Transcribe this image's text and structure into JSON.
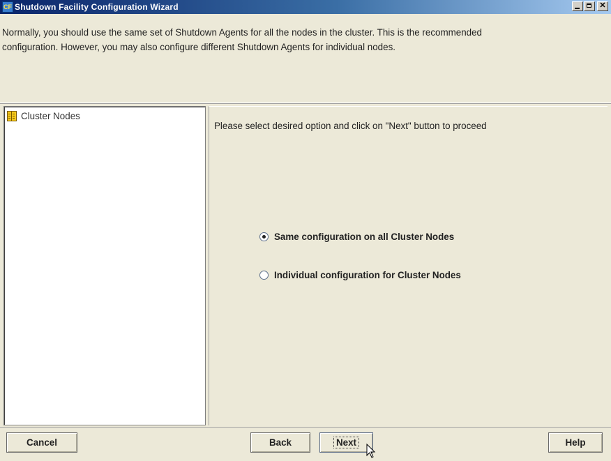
{
  "window": {
    "title": "Shutdown Facility Configuration Wizard",
    "controls": {
      "minimize": "",
      "maximize": "",
      "close": "✕"
    }
  },
  "info": {
    "line1": "Normally, you should use the same set of Shutdown Agents for all the nodes in the cluster. This is the recommended",
    "line2": "configuration. However, you may also configure different Shutdown Agents for individual nodes."
  },
  "tree": {
    "root_label": "Cluster Nodes",
    "root_icon": "book-icon"
  },
  "main": {
    "prompt": "Please select desired option and  click on \"Next\" button to proceed",
    "options": [
      {
        "label": "Same configuration on all Cluster Nodes",
        "selected": true
      },
      {
        "label": "Individual configuration for Cluster Nodes",
        "selected": false
      }
    ]
  },
  "buttons": {
    "cancel": "Cancel",
    "back": "Back",
    "next": "Next",
    "help": "Help"
  },
  "colors": {
    "title_start": "#0a246a",
    "title_end": "#a6caf0",
    "panel": "#ece9d8"
  }
}
